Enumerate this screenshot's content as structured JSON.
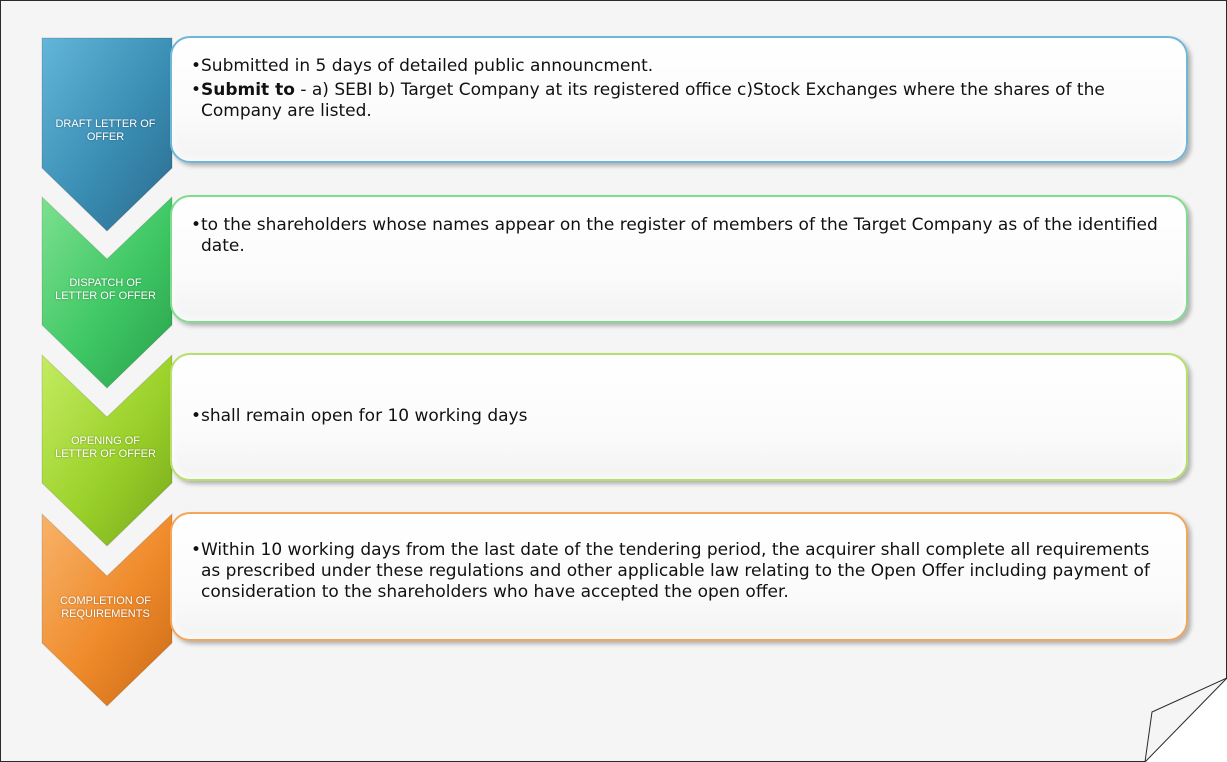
{
  "steps": [
    {
      "label_lines": [
        "DRAFT LETTER OF",
        "OFFER"
      ],
      "color": "#3a8db3",
      "border": "#6fb7d9",
      "bullets": [
        {
          "text": "Submitted in 5 days of detailed public announcment."
        },
        {
          "strong": "Submit to",
          "text": " - a) SEBI b) Target Company at its registered office c)Stock Exchanges where the shares of the Company are listed."
        }
      ]
    },
    {
      "label_lines": [
        "DISPATCH OF",
        "LETTER OF OFFER"
      ],
      "color": "#3ec764",
      "border": "#7fdc8e",
      "bullets": [
        {
          "text": "to the shareholders whose names appear on the register of members of the Target Company as of the identified date."
        }
      ]
    },
    {
      "label_lines": [
        "OPENING OF",
        "LETTER OF OFFER"
      ],
      "color": "#9bd12a",
      "border": "#b6df6b",
      "bullets": [
        {
          "text": "shall remain open for 10 working days"
        }
      ]
    },
    {
      "label_lines": [
        "COMPLETION OF",
        "REQUIREMENTS"
      ],
      "color": "#ef8a2a",
      "border": "#f1a659",
      "bullets": [
        {
          "text": "Within 10 working days from the last date of the tendering period, the acquirer shall complete all requirements as prescribed under these regulations and other applicable law relating to the Open Offer including payment of consideration to the shareholders who have accepted the open offer."
        }
      ]
    }
  ]
}
